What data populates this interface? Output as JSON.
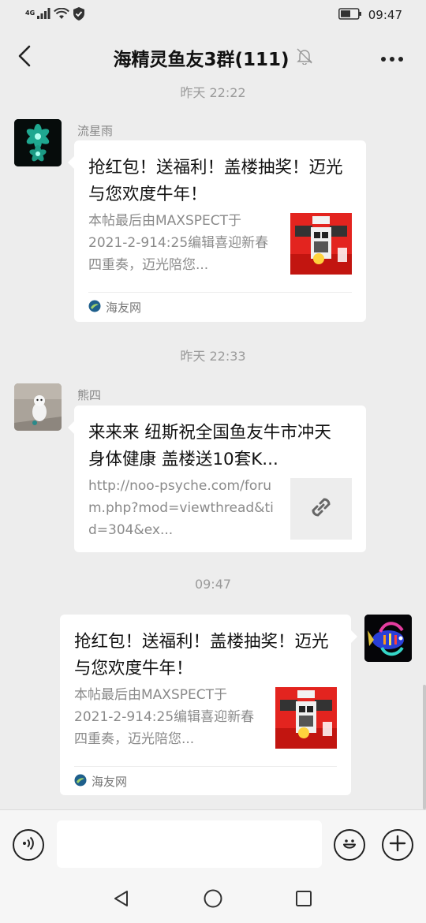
{
  "status_bar": {
    "network": "4G",
    "time": "09:47",
    "icons": [
      "signal-icon",
      "wifi-icon",
      "shield-icon",
      "battery-icon"
    ]
  },
  "header": {
    "back_icon": "chevron-left-icon",
    "title": "海精灵鱼友3群(111)",
    "mute_icon": "bell-off-icon",
    "more_icon": "more-icon"
  },
  "messages": [
    {
      "timestamp": "昨天 22:22",
      "sender": "流星雨",
      "side": "left",
      "card_title": "抢红包！送福利！盖楼抽奖！迈光与您欢度牛年！",
      "card_desc": "本帖最后由MAXSPECT于2021-2-914:25编辑喜迎新春四重奏，迈光陪您...",
      "source": "海友网",
      "thumb": "red-promo-image"
    },
    {
      "timestamp": "昨天 22:33",
      "sender": "熊四",
      "side": "left",
      "card_title": "来来来 纽斯祝全国鱼友牛市冲天 身体健康 盖楼送10套K...",
      "card_desc": "http://noo-psyche.com/forum.php?mod=viewthread&tid=304&ex...",
      "thumb": "link-icon"
    },
    {
      "timestamp": "09:47",
      "side": "right",
      "card_title": "抢红包！送福利！盖楼抽奖！迈光与您欢度牛年！",
      "card_desc": "本帖最后由MAXSPECT于2021-2-914:25编辑喜迎新春四重奏，迈光陪您...",
      "source": "海友网",
      "thumb": "red-promo-image"
    }
  ],
  "input_bar": {
    "voice_icon": "voice-icon",
    "input_value": "",
    "emoji_icon": "emoji-icon",
    "plus_icon": "plus-icon"
  },
  "nav_bar": {
    "icons": [
      "nav-back-icon",
      "nav-home-icon",
      "nav-recents-icon"
    ]
  },
  "colors": {
    "background": "#ededed",
    "card": "#ffffff",
    "promo_red": "#e3241f",
    "muted_text": "#8a8a8a"
  }
}
